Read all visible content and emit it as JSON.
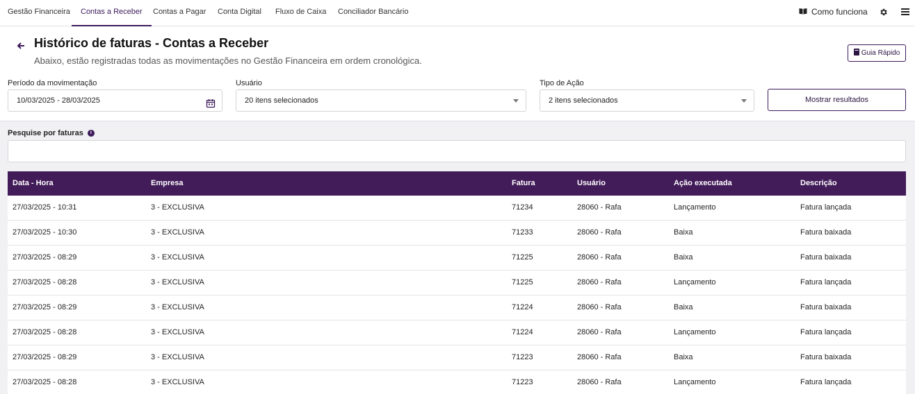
{
  "nav": {
    "tabs": [
      {
        "label": "Gestão Financeira"
      },
      {
        "label": "Contas a Receber"
      },
      {
        "label": "Contas a Pagar"
      },
      {
        "label": "Conta Digital"
      },
      {
        "label": "Fluxo de Caixa"
      },
      {
        "label": "Conciliador Bancário"
      }
    ],
    "active_tab": "Contas a Receber",
    "help_label": "Como funciona"
  },
  "header": {
    "title": "Histórico de faturas - Contas a Receber",
    "subtitle": "Abaixo, estão registradas todas as movimentações no Gestão Financeira em ordem cronológica.",
    "guide_button": "Guia Rápido"
  },
  "filters": {
    "period_label": "Período da movimentação",
    "period_value": "10/03/2025 - 28/03/2025",
    "user_label": "Usuário",
    "user_value": "20 itens selecionados",
    "action_label": "Tipo de Ação",
    "action_value": "2 itens selecionados",
    "submit_label": "Mostrar resultados"
  },
  "search": {
    "label": "Pesquise por faturas",
    "value": ""
  },
  "table": {
    "columns": [
      "Data - Hora",
      "Empresa",
      "Fatura",
      "Usuário",
      "Ação executada",
      "Descrição"
    ],
    "rows": [
      [
        "27/03/2025 - 10:31",
        "3 - EXCLUSIVA",
        "71234",
        "28060 - Rafa",
        "Lançamento",
        "Fatura lançada"
      ],
      [
        "27/03/2025 - 10:30",
        "3 - EXCLUSIVA",
        "71233",
        "28060 - Rafa",
        "Baixa",
        "Fatura baixada"
      ],
      [
        "27/03/2025 - 08:29",
        "3 - EXCLUSIVA",
        "71225",
        "28060 - Rafa",
        "Baixa",
        "Fatura baixada"
      ],
      [
        "27/03/2025 - 08:28",
        "3 - EXCLUSIVA",
        "71225",
        "28060 - Rafa",
        "Lançamento",
        "Fatura lançada"
      ],
      [
        "27/03/2025 - 08:29",
        "3 - EXCLUSIVA",
        "71224",
        "28060 - Rafa",
        "Baixa",
        "Fatura baixada"
      ],
      [
        "27/03/2025 - 08:28",
        "3 - EXCLUSIVA",
        "71224",
        "28060 - Rafa",
        "Lançamento",
        "Fatura lançada"
      ],
      [
        "27/03/2025 - 08:29",
        "3 - EXCLUSIVA",
        "71223",
        "28060 - Rafa",
        "Baixa",
        "Fatura baixada"
      ],
      [
        "27/03/2025 - 08:28",
        "3 - EXCLUSIVA",
        "71223",
        "28060 - Rafa",
        "Lançamento",
        "Fatura lançada"
      ]
    ]
  },
  "colors": {
    "brand": "#421b59",
    "page_bg": "#f1f1f4"
  },
  "icons": [
    "book-icon",
    "gear-icon",
    "menu-icon",
    "back-arrow-icon",
    "calendar-icon",
    "chevron-down-icon",
    "info-icon"
  ]
}
